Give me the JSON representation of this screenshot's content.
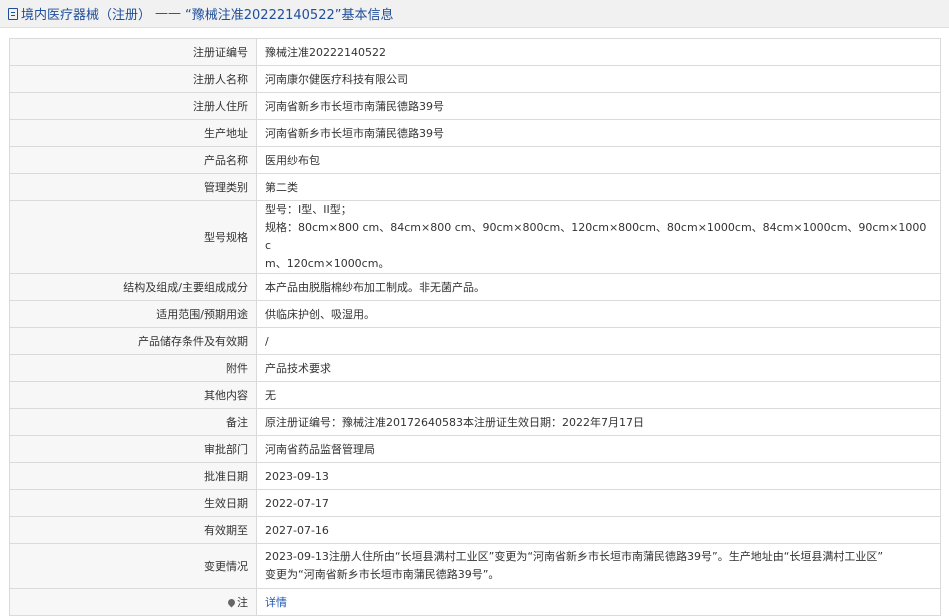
{
  "header": {
    "category": "境内医疗器械（注册）",
    "separator": "——",
    "title": "“豫械注准20222140522”基本信息"
  },
  "rows": [
    {
      "label": "注册证编号",
      "value": "豫械注准20222140522"
    },
    {
      "label": "注册人名称",
      "value": "河南康尔健医疗科技有限公司"
    },
    {
      "label": "注册人住所",
      "value": "河南省新乡市长垣市南蒲民德路39号"
    },
    {
      "label": "生产地址",
      "value": "河南省新乡市长垣市南蒲民德路39号"
    },
    {
      "label": "产品名称",
      "value": "医用纱布包"
    },
    {
      "label": "管理类别",
      "value": "第二类"
    },
    {
      "label": "型号规格",
      "lines": [
        "型号：I型、II型；",
        "规格：80cm×800 cm、84cm×800 cm、90cm×800cm、120cm×800cm、80cm×1000cm、84cm×1000cm、90cm×1000 c",
        "m、120cm×1000cm。"
      ]
    },
    {
      "label": "结构及组成/主要组成成分",
      "value": "本产品由脱脂棉纱布加工制成。非无菌产品。"
    },
    {
      "label": "适用范围/预期用途",
      "value": "供临床护创、吸湿用。"
    },
    {
      "label": "产品储存条件及有效期",
      "value": "/"
    },
    {
      "label": "附件",
      "value": "产品技术要求"
    },
    {
      "label": "其他内容",
      "value": "无"
    },
    {
      "label": "备注",
      "value": "原注册证编号：豫械注准20172640583本注册证生效日期：2022年7月17日"
    },
    {
      "label": "审批部门",
      "value": "河南省药品监督管理局"
    },
    {
      "label": "批准日期",
      "value": "2023-09-13"
    },
    {
      "label": "生效日期",
      "value": "2022-07-17"
    },
    {
      "label": "有效期至",
      "value": "2027-07-16"
    },
    {
      "label": "变更情况",
      "lines": [
        "2023-09-13注册人住所由“长垣县满村工业区”变更为“河南省新乡市长垣市南蒲民德路39号”。生产地址由“长垣县满村工业区”",
        "变更为“河南省新乡市长垣市南蒲民德路39号”。"
      ]
    },
    {
      "label": "注",
      "value": "详情",
      "icon": "map-pin-icon"
    }
  ]
}
